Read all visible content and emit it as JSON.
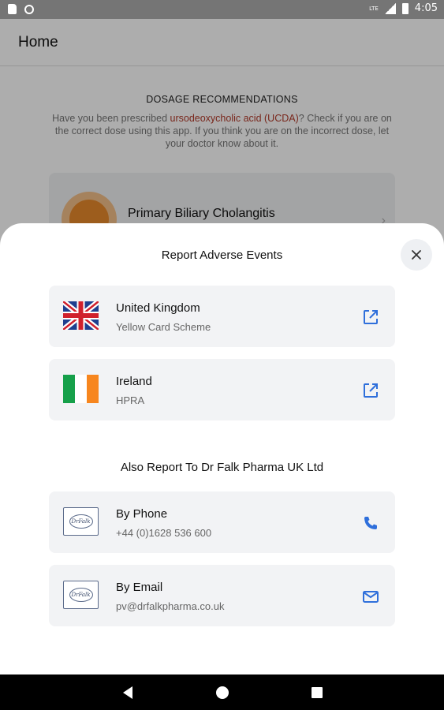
{
  "status_bar": {
    "time": "4:05",
    "network": "LTE"
  },
  "app_bar": {
    "title": "Home"
  },
  "dosage": {
    "heading": "DOSAGE RECOMMENDATIONS",
    "text_before": "Have you been prescribed ",
    "highlight": "ursodeoxycholic acid (UCDA)",
    "text_after": "? Check if you are on the correct dose using this app. If you think you are on the incorrect dose, let your doctor know about it.",
    "highlight_color": "#b33a2a"
  },
  "condition_card": {
    "title": "Primary Biliary Cholangitis"
  },
  "sheet": {
    "title": "Report Adverse Events",
    "close_icon": "close-icon",
    "regulators": [
      {
        "title": "United Kingdom",
        "subtitle": "Yellow Card Scheme",
        "flag": "uk-flag",
        "action_icon": "open-external-icon"
      },
      {
        "title": "Ireland",
        "subtitle": "HPRA",
        "flag": "ireland-flag",
        "action_icon": "open-external-icon"
      }
    ],
    "section_title": "Also Report To Dr Falk Pharma UK Ltd",
    "contacts": [
      {
        "title": "By Phone",
        "subtitle": "+44 (0)1628 536 600",
        "logo_text": "DrFalk",
        "action_icon": "phone-icon"
      },
      {
        "title": "By Email",
        "subtitle": "pv@drfalkpharma.co.uk",
        "logo_text": "DrFalk",
        "action_icon": "mail-icon"
      }
    ]
  },
  "colors": {
    "accent": "#2f6fdb",
    "card_bg": "#f2f3f5",
    "scrim": "rgba(0,0,0,0.32)"
  }
}
